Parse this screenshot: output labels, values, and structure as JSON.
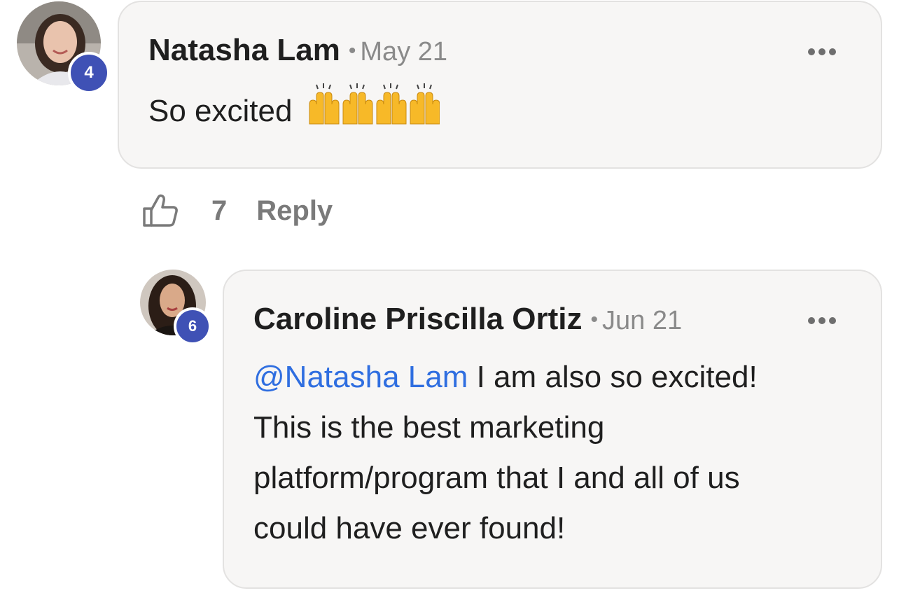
{
  "comment": {
    "author": "Natasha Lam",
    "separator": "•",
    "date": "May 21",
    "text": "So excited",
    "emoji": [
      "hands-raised-icon",
      "hands-raised-icon",
      "hands-raised-icon",
      "hands-raised-icon"
    ],
    "badge_level": "4",
    "likes": "7",
    "reply_label": "Reply"
  },
  "reply": {
    "author": "Caroline Priscilla Ortiz",
    "separator": "•",
    "date": "Jun 21",
    "mention": "@Natasha Lam",
    "text_line1": " I am also so excited!",
    "text_line2": "This is the best marketing",
    "text_line3": "platform/program that I and all of us",
    "text_line4": "could have ever found!",
    "badge_level": "6"
  },
  "colors": {
    "badge": "#3f51b5",
    "mention": "#2f6ee0",
    "bubble": "#f7f6f5"
  }
}
